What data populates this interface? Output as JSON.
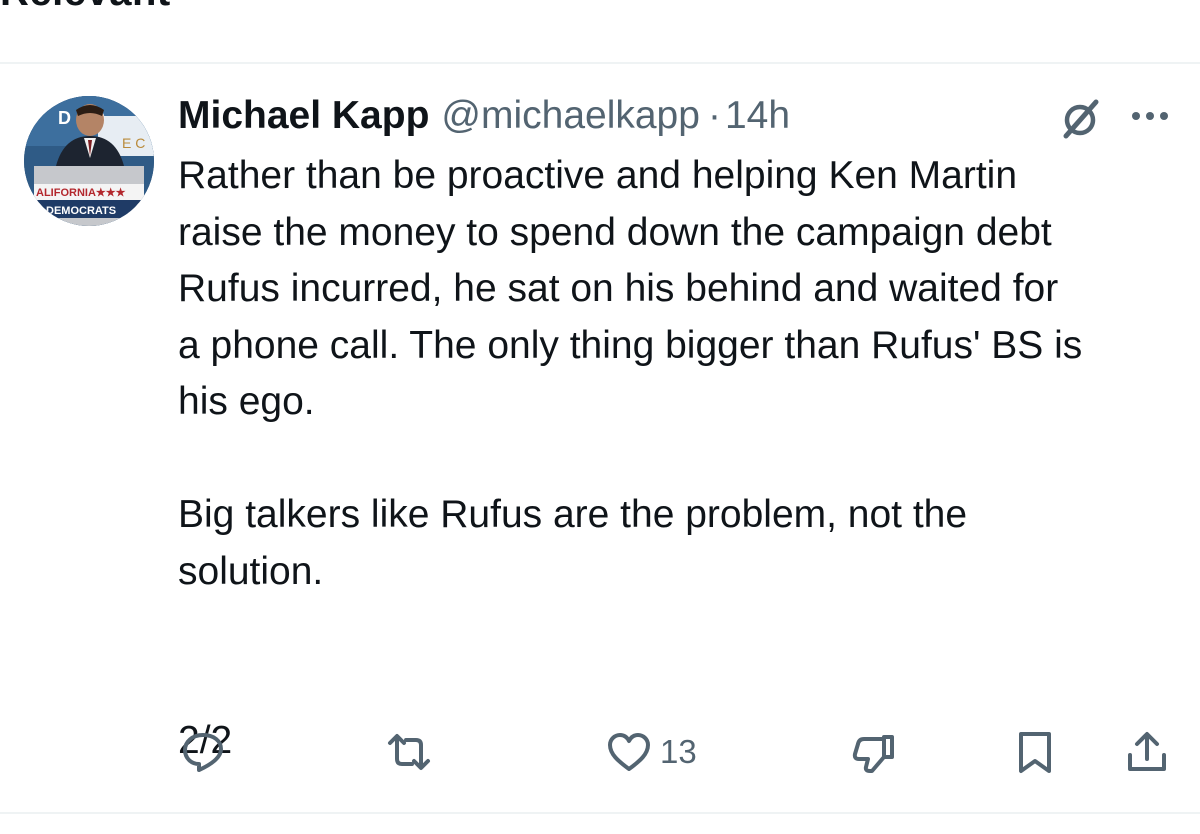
{
  "filter": {
    "label": "Relevant"
  },
  "tweet": {
    "author_name": "Michael Kapp",
    "handle": "@michaelkapp",
    "separator": "·",
    "time": "14h",
    "avatar": {
      "banner_text": "ALIFORNIA★★★",
      "banner_sub": "DEMOCRATS",
      "backdrop_text": "D MO"
    },
    "body": "Rather than be proactive and helping Ken Martin\nraise the money to spend down the campaign debt\nRufus incurred, he sat on his behind and waited for\na phone call. The only thing bigger than Rufus' BS is\nhis ego.\n\nBig talkers like Rufus are the problem, not the\nsolution.\n\n\n2/2",
    "actions": {
      "like_count": "13"
    },
    "icons": [
      "grok-icon",
      "more-icon",
      "reply-icon",
      "retweet-icon",
      "like-icon",
      "dislike-icon",
      "bookmark-icon",
      "share-icon"
    ]
  },
  "colors": {
    "text": "#0f1419",
    "secondary": "#536471",
    "divider": "#eff3f4"
  }
}
